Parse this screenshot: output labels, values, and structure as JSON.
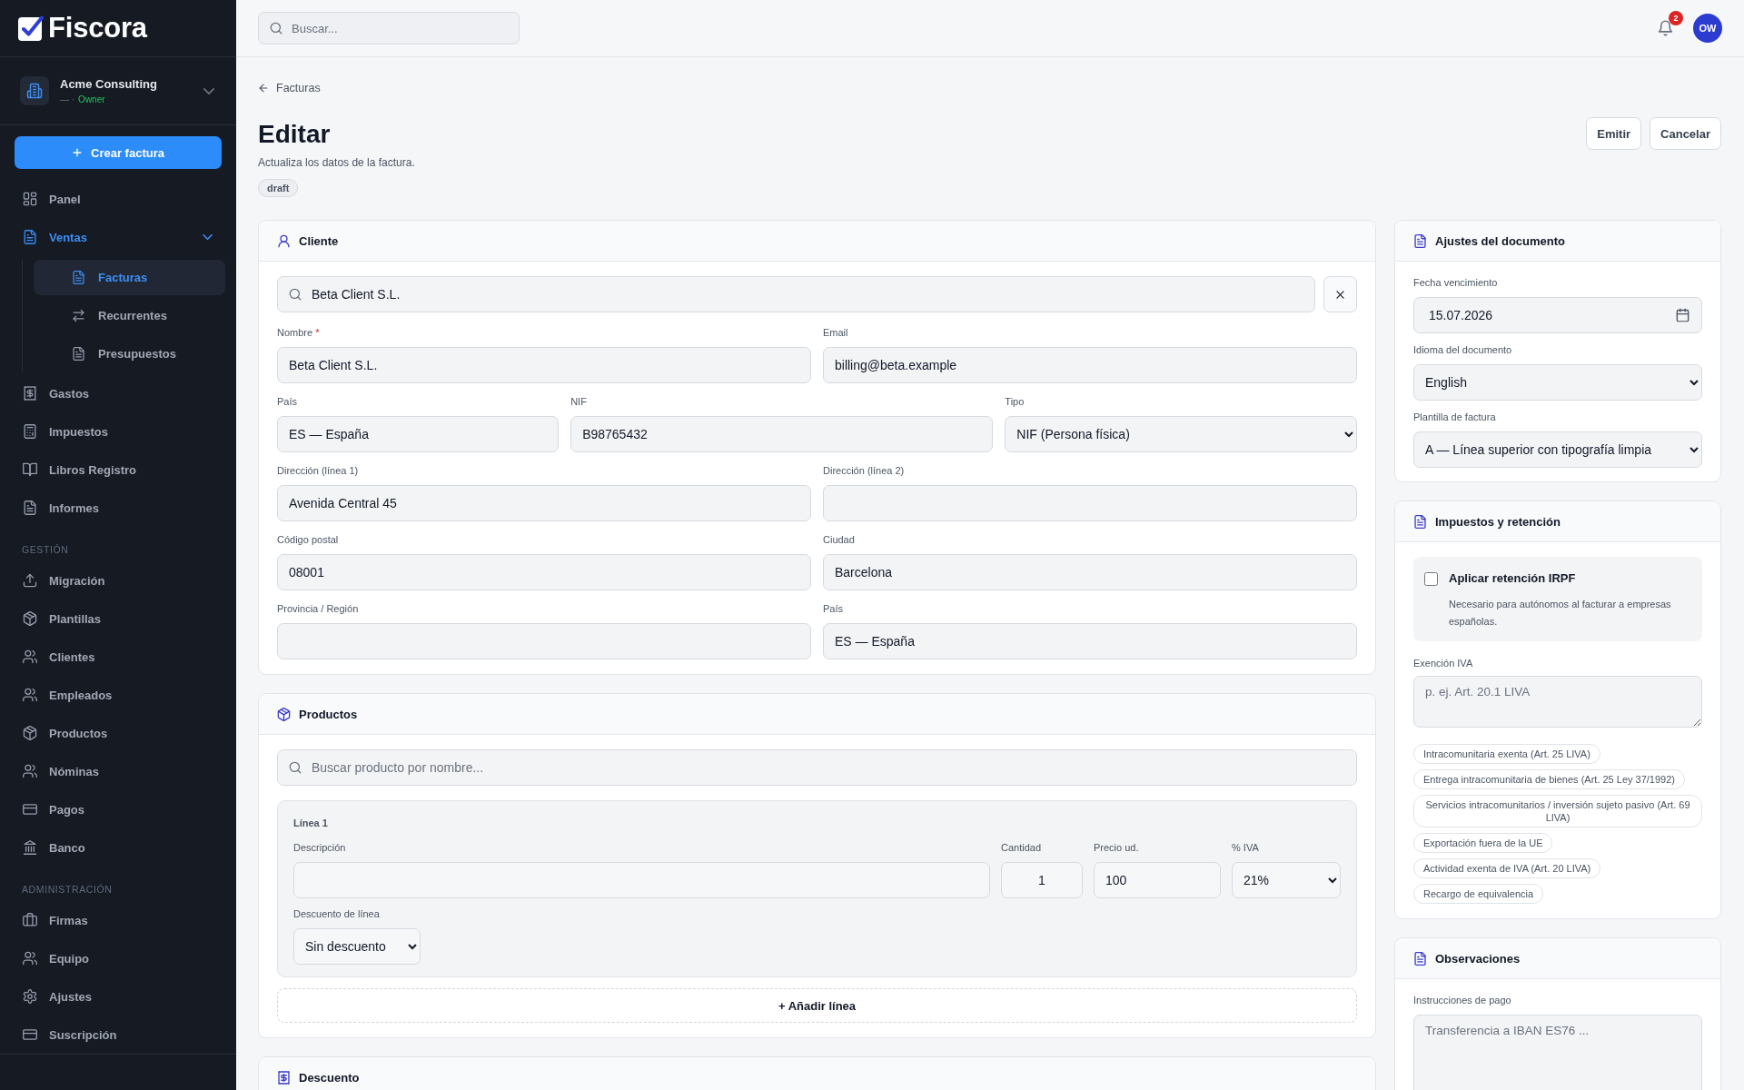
{
  "sidebar": {
    "logo": "Fiscora",
    "organization": {
      "name": "Acme Consulting",
      "detail": "— ·",
      "role": "Owner"
    },
    "create_button": "Crear factura",
    "nav": [
      {
        "items": [
          {
            "label": "Panel",
            "selected": false
          },
          {
            "label": "Ventas",
            "selected": true,
            "expanded": true,
            "children": [
              {
                "label": "Facturas",
                "selected": true
              },
              {
                "label": "Recurrentes",
                "selected": false
              },
              {
                "label": "Presupuestos",
                "selected": false
              }
            ]
          },
          {
            "label": "Gastos",
            "selected": false
          },
          {
            "label": "Impuestos",
            "selected": false
          },
          {
            "label": "Libros Registro",
            "selected": false
          },
          {
            "label": "Informes",
            "selected": false
          }
        ]
      },
      {
        "heading": "GESTIÓN",
        "items": [
          {
            "label": "Migración",
            "selected": false
          },
          {
            "label": "Plantillas",
            "selected": false
          },
          {
            "label": "Clientes",
            "selected": false
          },
          {
            "label": "Empleados",
            "selected": false
          },
          {
            "label": "Productos",
            "selected": false
          },
          {
            "label": "Nóminas",
            "selected": false
          },
          {
            "label": "Pagos",
            "selected": false
          },
          {
            "label": "Banco",
            "selected": false
          }
        ]
      },
      {
        "heading": "ADMINISTRACIÓN",
        "items": [
          {
            "label": "Firmas",
            "selected": false
          },
          {
            "label": "Equipo",
            "selected": false
          },
          {
            "label": "Ajustes",
            "selected": false
          },
          {
            "label": "Suscripción",
            "selected": false
          }
        ]
      }
    ]
  },
  "topbar": {
    "search": {
      "placeholder": "Buscar..."
    },
    "notifications": "2",
    "avatar": "OW"
  },
  "page": {
    "back_link": "Facturas",
    "title": "Editar",
    "subtitle": "Actualiza los datos de la factura.",
    "status": "draft",
    "actions": [
      "Emitir",
      "Cancelar"
    ]
  },
  "client": {
    "title": "Cliente",
    "search": {
      "value": "Beta Client S.L."
    },
    "rows": [
      [
        {
          "label": "Nombre",
          "required_mark": "*",
          "value": "Beta Client S.L.",
          "kind": "text"
        },
        {
          "label": "Email",
          "value": "billing@beta.example",
          "kind": "text"
        }
      ],
      [
        {
          "label": "País",
          "value": "ES — España",
          "kind": "text"
        },
        {
          "label": "NIF",
          "value": "B98765432",
          "kind": "text"
        },
        {
          "label": "Tipo",
          "value": "NIF (Persona física)",
          "kind": "select"
        }
      ],
      [
        {
          "label": "Dirección (línea 1)",
          "value": "Avenida Central 45",
          "kind": "text"
        },
        {
          "label": "Dirección (línea 2)",
          "kind": "text"
        }
      ],
      [
        {
          "label": "Código postal",
          "value": "08001",
          "kind": "text"
        },
        {
          "label": "Ciudad",
          "value": "Barcelona",
          "kind": "text"
        }
      ],
      [
        {
          "label": "Provincia / Región",
          "kind": "text"
        },
        {
          "label": "País",
          "value": "ES — España",
          "kind": "text"
        }
      ]
    ]
  },
  "products": {
    "title": "Productos",
    "search": {
      "placeholder": "Buscar producto por nombre..."
    },
    "lines": [
      {
        "title": "Línea 1",
        "fields": [
          {
            "label": "Descripción",
            "kind": "text"
          },
          {
            "label": "Cantidad",
            "value": "1",
            "kind": "number"
          },
          {
            "label": "Precio ud.",
            "value": "100",
            "kind": "text"
          },
          {
            "label": "% IVA",
            "value": "21%",
            "kind": "select"
          }
        ],
        "discount": {
          "label": "Descuento de línea",
          "value": "Sin descuento",
          "kind": "select"
        }
      }
    ],
    "add_button": "+ Añadir línea"
  },
  "discount": {
    "title": "Descuento"
  },
  "document_settings": {
    "title": "Ajustes del documento",
    "fields": [
      {
        "label": "Fecha vencimiento",
        "value": "15.07.2026",
        "kind": "date"
      },
      {
        "label": "Idioma del documento",
        "value": "English",
        "kind": "select"
      },
      {
        "label": "Plantilla de factura",
        "value": "A — Línea superior con tipografía limpia",
        "kind": "select"
      }
    ]
  },
  "taxes": {
    "title": "Impuestos y retención",
    "irpf": {
      "label": "Aplicar retención IRPF",
      "hint": "Necesario para autónomos al facturar a empresas españolas.",
      "checked": false
    },
    "exemption": {
      "label": "Exención IVA",
      "placeholder": "p. ej. Art. 20.1 LIVA",
      "suggestions": [
        "Intracomunitaria exenta (Art. 25 LIVA)",
        "Entrega intracomunitaria de bienes (Art. 25 Ley 37/1992)",
        "Servicios intracomunitarios / inversión sujeto pasivo (Art. 69 LIVA)",
        "Exportación fuera de la UE",
        "Actividad exenta de IVA (Art. 20 LIVA)",
        "Recargo de equivalencia"
      ]
    }
  },
  "notes": {
    "title": "Observaciones",
    "fields": [
      {
        "label": "Instrucciones de pago",
        "placeholder": "Transferencia a IBAN ES76 ..."
      }
    ]
  }
}
